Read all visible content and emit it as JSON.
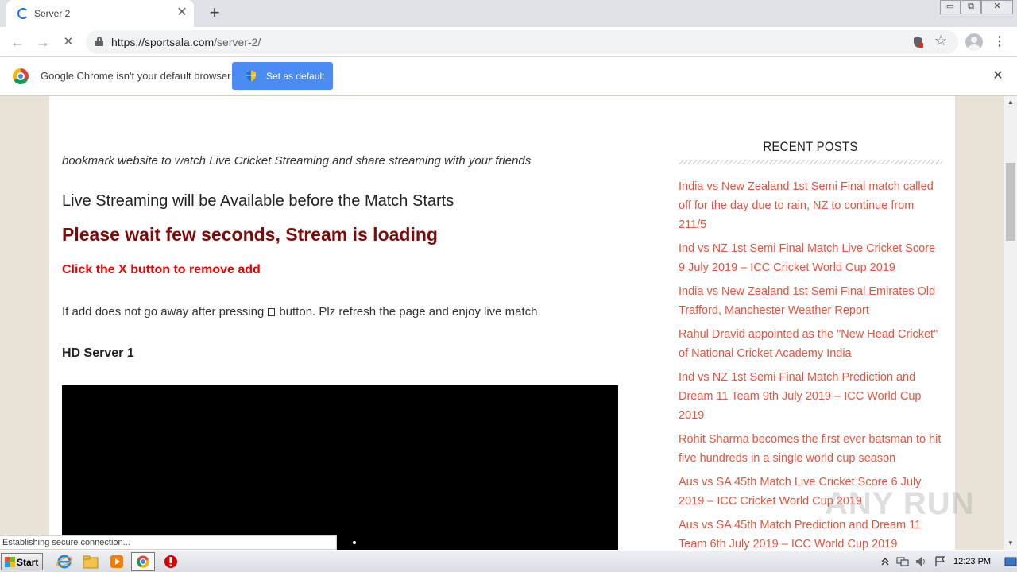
{
  "browser": {
    "tab_title": "Server 2",
    "tab_close": "✕",
    "new_tab": "+",
    "url_host": "https://sportsala.com",
    "url_path": "/server-2/",
    "window_buttons": [
      "▭",
      "⧉",
      "✕"
    ],
    "nav": {
      "back": "←",
      "forward": "→",
      "reload": "✕"
    },
    "menu": "⋮",
    "star": "☆"
  },
  "infobar": {
    "message": "Google Chrome isn't your default browser",
    "button_label": "Set as default",
    "close": "✕"
  },
  "page": {
    "intro": "bookmark website to watch Live Cricket Streaming and share streaming with your friends",
    "subhead": "Live Streaming will be Available before the Match Starts",
    "loading": "Please wait few seconds, Stream is loading",
    "click_x": "Click the X button to remove add",
    "refresh_before": "If add does not go away after pressing",
    "refresh_after": "button. Plz refresh the page and enjoy live match.",
    "server_label": "HD Server 1"
  },
  "sidebar": {
    "title": "RECENT POSTS",
    "posts": [
      "India vs New Zealand 1st Semi Final match called off for the day due to rain, NZ to continue from 211/5",
      "Ind vs NZ 1st Semi Final Match Live Cricket Score 9 July 2019 – ICC Cricket World Cup 2019",
      "India vs New Zealand 1st Semi Final Emirates Old Trafford, Manchester Weather Report",
      "Rahul Dravid appointed as the \"New Head Cricket\" of National Cricket Academy India",
      "Ind vs NZ 1st Semi Final Match Prediction and Dream 11 Team 9th July 2019 – ICC World Cup 2019",
      "Rohit Sharma becomes the first ever batsman to hit five hundreds in a single world cup season",
      "Aus vs SA 45th Match Live Cricket Score 6 July 2019 – ICC Cricket World Cup 2019",
      "Aus vs SA 45th Match Prediction and Dream 11 Team 6th July 2019 – ICC World Cup 2019"
    ]
  },
  "status": "Establishing secure connection...",
  "watermark": "ANY RUN",
  "taskbar": {
    "start_label": "Start",
    "clock": "12:23 PM"
  },
  "colors": {
    "accent_button": "#4b8bf4",
    "loading_text": "#7b0b0b",
    "warning_text": "#ee0000",
    "post_link": "#e4533d",
    "page_background": "#e8e3d6"
  }
}
